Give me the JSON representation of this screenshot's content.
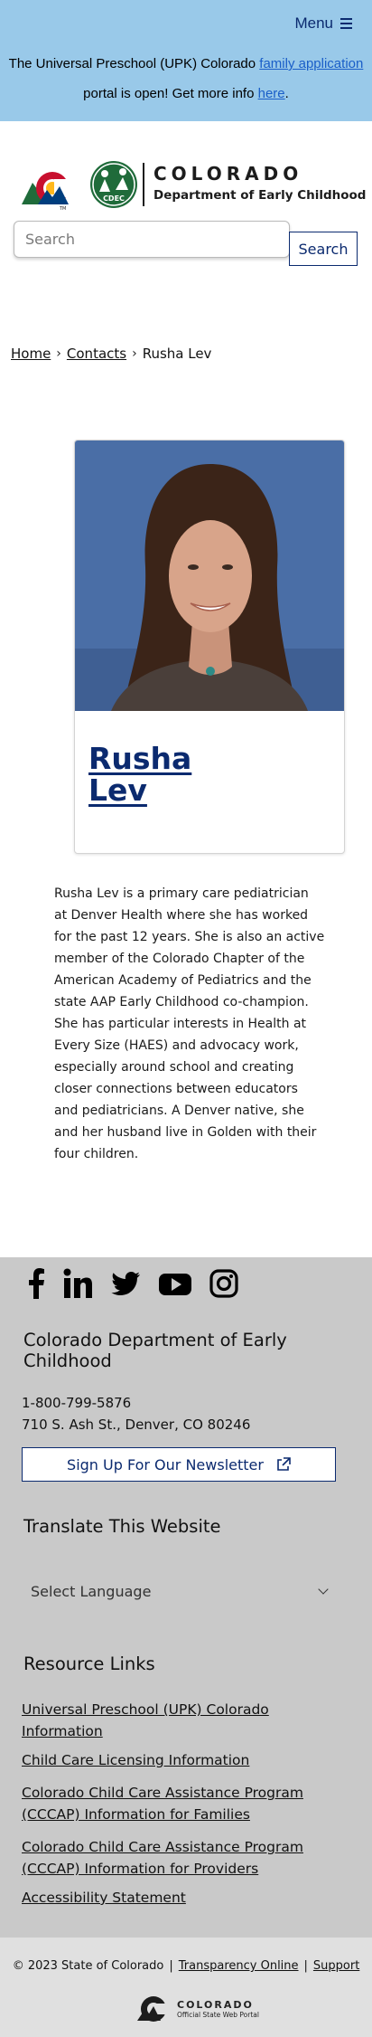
{
  "banner": {
    "menu_label": "Menu",
    "notice_before": "The Universal Preschool (UPK) Colorado ",
    "notice_link1": "family application",
    "notice_middle": "portal is open! Get more info ",
    "notice_link2": "here",
    "notice_end": "."
  },
  "logo": {
    "state_word": "COLORADO",
    "department": "Department of Early Childhood",
    "badge_text": "CDEC",
    "tm": "TM"
  },
  "search": {
    "placeholder": "Search",
    "button_label": "Search"
  },
  "breadcrumb": {
    "items": [
      "Home",
      "Contacts",
      "Rusha Lev"
    ],
    "separator": "›"
  },
  "profile": {
    "first_name": "Rusha",
    "last_name": "Lev",
    "bio": "Rusha Lev is a primary care pediatrician at Denver Health where she has worked for the past 12 years. She is also an active member of the Colorado Chapter of the American Academy of Pediatrics and the state AAP Early Childhood co-champion. She has particular interests in Health at Every Size (HAES) and advocacy work, especially around school and creating closer connections between educators and pediatricians. A Denver native, she and her husband live in Golden with their four children."
  },
  "footer": {
    "social_icons": [
      "facebook-icon",
      "linkedin-icon",
      "twitter-icon",
      "youtube-icon",
      "instagram-icon"
    ],
    "org_name": "Colorado Department of Early Childhood",
    "phone": "1-800-799-5876",
    "address": "710 S. Ash St., Denver, CO 80246",
    "newsletter_label": "Sign Up For Our Newsletter",
    "translate_heading": "Translate This Website",
    "language_select": "Select Language",
    "resources_heading": "Resource Links",
    "resource_links": [
      "Universal Preschool (UPK) Colorado Information",
      "Child Care Licensing Information",
      "Colorado Child Care Assistance Program (CCCAP) Information for Families",
      "Colorado Child Care Assistance Program (CCCAP) Information for Providers",
      "Accessibility Statement"
    ]
  },
  "bottom_bar": {
    "copyright": "© 2023 State of Colorado",
    "transparency_link": "Transparency Online",
    "support_link": "Support",
    "separator": "|",
    "portal_title": "COLORADO",
    "portal_subtitle": "Official State Web Portal"
  },
  "colors": {
    "banner_bg": "#99c9e9",
    "brand_navy": "#0b2a6f",
    "link_blue": "#1a5ec8",
    "footer_bg": "#c9c9c9",
    "bottom_bar_bg": "#e0e0e0"
  }
}
